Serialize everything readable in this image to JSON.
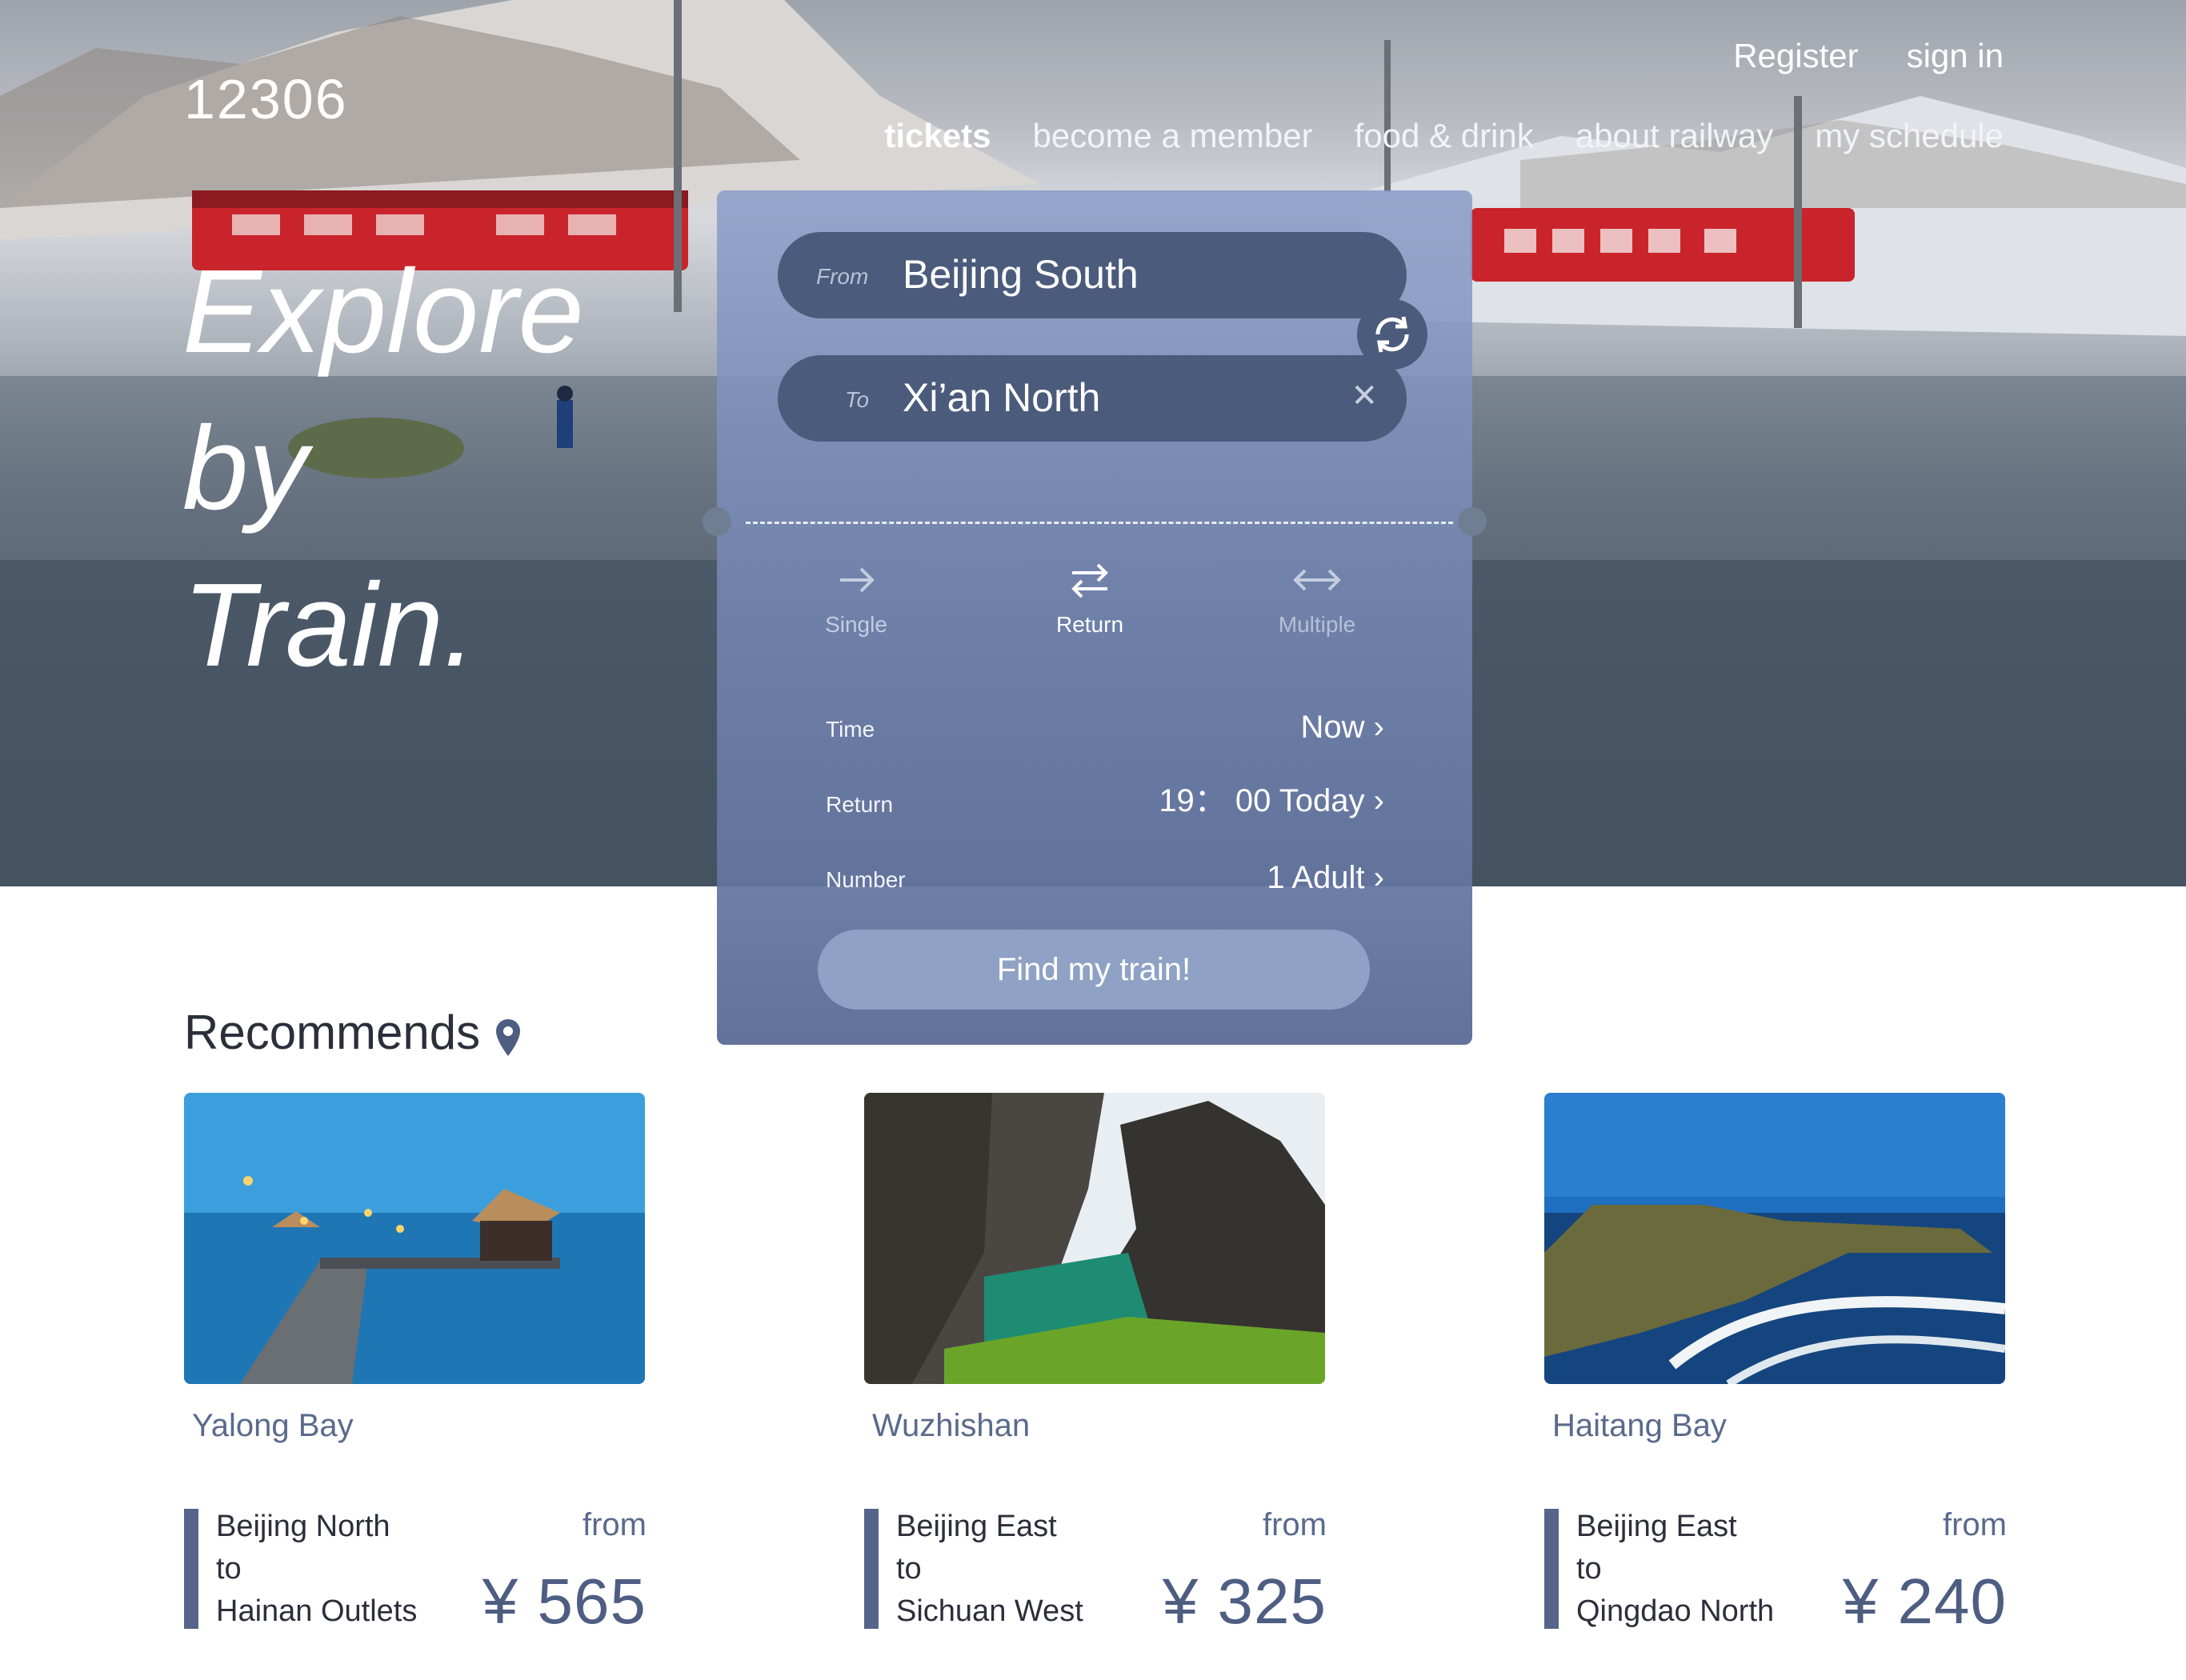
{
  "header": {
    "logo": "12306",
    "register": "Register",
    "sign_in": "sign in",
    "nav": [
      "tickets",
      "become a member",
      "food & drink",
      "about railway",
      "my schedule"
    ]
  },
  "hero": {
    "headline": [
      "Explore",
      "by",
      "Train."
    ]
  },
  "booking": {
    "from_label": "From",
    "from_value": "Beijing South",
    "to_label": "To",
    "to_value": "Xi’an North",
    "trip_types": [
      {
        "label": "Single",
        "icon": "arrow-right-icon",
        "selected": false
      },
      {
        "label": "Return",
        "icon": "arrows-swap-icon",
        "selected": true
      },
      {
        "label": "Multiple",
        "icon": "arrow-both-icon",
        "selected": false
      }
    ],
    "rows": [
      {
        "label": "Time",
        "value": "Now"
      },
      {
        "label": "Return",
        "value": "19： 00 Today"
      },
      {
        "label": "Number",
        "value": "1 Adult"
      }
    ],
    "submit": "Find my train!"
  },
  "recommends": {
    "title": "Recommends",
    "items": [
      {
        "place": "Yalong Bay",
        "origin": "Beijing North",
        "to": "to",
        "destination": "Hainan Outlets",
        "from_label": "from",
        "price": "¥ 565"
      },
      {
        "place": "Wuzhishan",
        "origin": "Beijing East",
        "to": "to",
        "destination": "Sichuan West",
        "from_label": "from",
        "price": "¥ 325"
      },
      {
        "place": "Haitang Bay",
        "origin": "Beijing East",
        "to": "to",
        "destination": "Qingdao North",
        "from_label": "from",
        "price": "¥ 240"
      }
    ]
  },
  "colors": {
    "accent": "#55648a",
    "card": "#7f8fb6",
    "field": "#4b5b7b",
    "button": "#8fa1c4"
  }
}
